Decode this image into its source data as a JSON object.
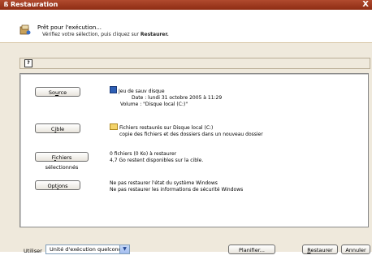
{
  "window": {
    "title": "Restauration",
    "close": "X"
  },
  "header": {
    "title": "Prêt pour l'exécution...",
    "subtitle_prefix": "Vérifiez votre sélection, puis cliquez sur ",
    "subtitle_bold": "Restaurer."
  },
  "help_icon": "?",
  "rows": {
    "source": {
      "button_parts": [
        "So",
        "u",
        "rce"
      ],
      "lines": [
        "Jeu de sauv disque",
        "Date : lundi 31 octobre 2005 à 11:29",
        "Volume : \"Disque local (C:)\""
      ]
    },
    "cible": {
      "button_parts": [
        "C",
        "i",
        "ble"
      ],
      "lines": [
        "Fichiers restaurés sur Disque local (C:)",
        "copie des fichiers et des dossiers dans un nouveau dossier"
      ]
    },
    "fichiers": {
      "button_parts": [
        "F",
        "i",
        "chiers sélectionnés"
      ],
      "lines": [
        "0 fichiers (0 Ko) à restaurer",
        "4,7 Go restent disponibles sur la cible."
      ]
    },
    "options": {
      "button_parts": [
        "Opt",
        "i",
        "ons"
      ],
      "lines": [
        "Ne pas restaurer l'état du système Windows",
        "Ne pas restaurer les informations de sécurité Windows"
      ]
    }
  },
  "bottom": {
    "use_label": "Utiliser",
    "select_value": "Unité d'exécution quelconque",
    "planifier_parts": [
      "Planif",
      "i",
      "er..."
    ],
    "restaurer_parts": [
      "",
      "R",
      "estaurer"
    ],
    "annuler": "Annuler"
  },
  "colors": {
    "titlebar": "#9b3a1f",
    "band": "#efe9dc",
    "select_border": "#7f9db9"
  }
}
